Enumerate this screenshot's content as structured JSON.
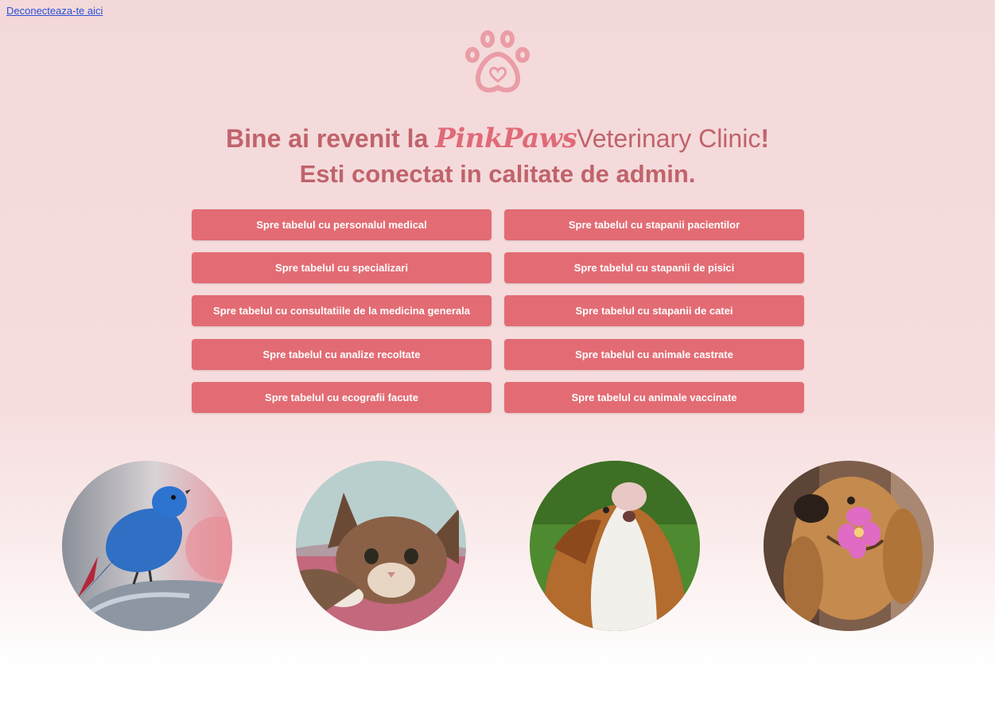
{
  "header": {
    "logout_link": "Deconecteaza-te aici"
  },
  "logo": {
    "icon": "paw-heart-icon",
    "color": "#ea9da6"
  },
  "welcome": {
    "line1_prefix": "Bine ai revenit la",
    "brand": "PinkPaws",
    "clinic": "Veterinary Clinic",
    "exclamation": "!",
    "line2": "Esti conectat in calitate de admin."
  },
  "buttons": {
    "left": [
      "Spre tabelul cu personalul medical",
      "Spre tabelul cu specializari",
      "Spre tabelul cu consultatiile de la medicina generala",
      "Spre tabelul cu analize recoltate",
      "Spre tabelul cu ecografii facute"
    ],
    "right": [
      "Spre tabelul cu stapanii pacientilor",
      "Spre tabelul cu stapanii de pisici",
      "Spre tabelul cu stapanii de catei",
      "Spre tabelul cu animale castrate",
      "Spre tabelul cu animale vaccinate"
    ]
  },
  "photos": [
    "bird-photo",
    "kitten-photo",
    "guinea-pig-photo",
    "dog-with-flower-photo"
  ],
  "colors": {
    "button": "#e36c74",
    "title": "#c0636b",
    "brand": "#e06a78",
    "background": "#f4d9da"
  }
}
